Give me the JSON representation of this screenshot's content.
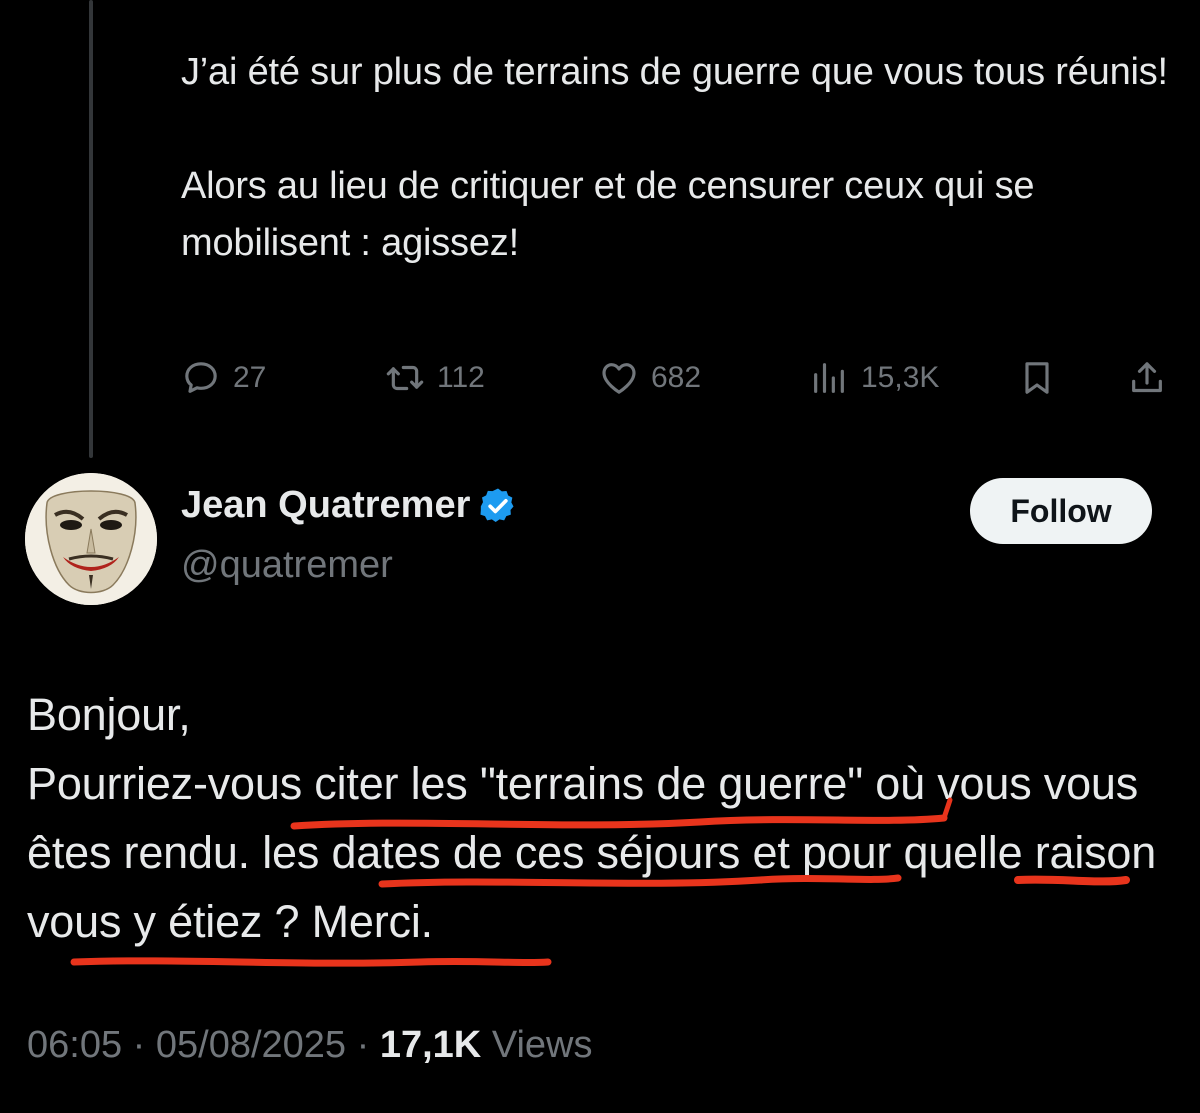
{
  "parent_tweet": {
    "paragraphs": [
      "J’ai été sur plus de terrains de guerre que vous tous réunis!",
      "Alors au lieu de critiquer et de censurer ceux qui se mobilisent : agissez!"
    ],
    "actions": {
      "replies": "27",
      "reposts": "112",
      "likes": "682",
      "views": "15,3K"
    }
  },
  "reply_tweet": {
    "author": {
      "name": "Jean Quatremer",
      "handle": "@quatremer",
      "verified": true,
      "verified_icon": "verified-badge-icon",
      "verified_color": "#1d9bf0"
    },
    "follow_label": "Follow",
    "text": {
      "line1": "Bonjour,",
      "line2": "Pourriez-vous citer les \"terrains de guerre\" où vous vous êtes rendu. les dates de ces séjours et pour quelle raison vous y étiez ? Merci."
    },
    "meta": {
      "time": "06:05",
      "separator": "·",
      "date": "05/08/2025",
      "views_count": "17,1K",
      "views_label": "Views"
    }
  },
  "colors": {
    "background": "#000000",
    "text": "#e7e9ea",
    "muted": "#71767b",
    "annotation_red": "#e8341c"
  },
  "icons": [
    "reply-icon",
    "repost-icon",
    "like-icon",
    "views-icon",
    "bookmark-icon",
    "share-icon"
  ]
}
